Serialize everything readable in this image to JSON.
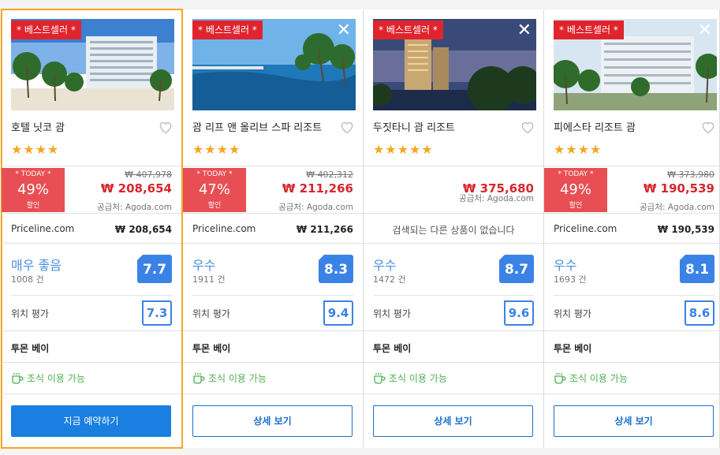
{
  "cards": [
    {
      "badge": "* 베스트셀러 *",
      "name": "호텔 닛코 괌",
      "stars": "★★★★",
      "deal": {
        "today": "* TODAY *",
        "pct": "49%",
        "label": "할인"
      },
      "old_price": "₩ 407,978",
      "price": "₩ 208,654",
      "supplier": "공급처: Agoda.com",
      "other_site": "Priceline.com",
      "other_price": "₩ 208,654",
      "rating_label": "매우 좋음",
      "reviews": "1008 건",
      "score": "7.7",
      "location_label": "위치 평가",
      "location_score": "7.3",
      "area": "투몬 베이",
      "amenity": "조식 이용 가능",
      "button": "지금 예약하기"
    },
    {
      "badge": "* 베스트셀러 *",
      "name": "괌 리프 앤 올리브 스파 리조트",
      "stars": "★★★★",
      "deal": {
        "today": "* TODAY *",
        "pct": "47%",
        "label": "할인"
      },
      "old_price": "₩ 402,312",
      "price": "₩ 211,266",
      "supplier": "공급처: Agoda.com",
      "other_site": "Priceline.com",
      "other_price": "₩ 211,266",
      "rating_label": "우수",
      "reviews": "1911 건",
      "score": "8.3",
      "location_label": "위치 평가",
      "location_score": "9.4",
      "area": "투몬 베이",
      "amenity": "조식 이용 가능",
      "button": "상세 보기"
    },
    {
      "badge": "* 베스트셀러 *",
      "name": "두짓타니 괌 리조트",
      "stars": "★★★★★",
      "price": "₩ 375,680",
      "supplier": "공급처: Agoda.com",
      "no_other": "검색되는 다른 상품이 없습니다",
      "rating_label": "우수",
      "reviews": "1472 건",
      "score": "8.7",
      "location_label": "위치 평가",
      "location_score": "9.6",
      "area": "투몬 베이",
      "amenity": "조식 이용 가능",
      "button": "상세 보기"
    },
    {
      "badge": "* 베스트셀러 *",
      "name": "피에스타 리조트 괌",
      "stars": "★★★★",
      "deal": {
        "today": "* TODAY *",
        "pct": "49%",
        "label": "할인"
      },
      "old_price": "₩ 373,980",
      "price": "₩ 190,539",
      "supplier": "공급처: Agoda.com",
      "other_site": "Priceline.com",
      "other_price": "₩ 190,539",
      "rating_label": "우수",
      "reviews": "1693 건",
      "score": "8.1",
      "location_label": "위치 평가",
      "location_score": "8.6",
      "area": "투몬 베이",
      "amenity": "조식 이용 가능",
      "button": "상세 보기"
    }
  ],
  "colors": {
    "badge": "#e0242e",
    "deal": "#e84f54",
    "price": "#d6262e",
    "score": "#3b82e6",
    "amenity": "#4caf50",
    "selected_outline": "#f5a623"
  }
}
